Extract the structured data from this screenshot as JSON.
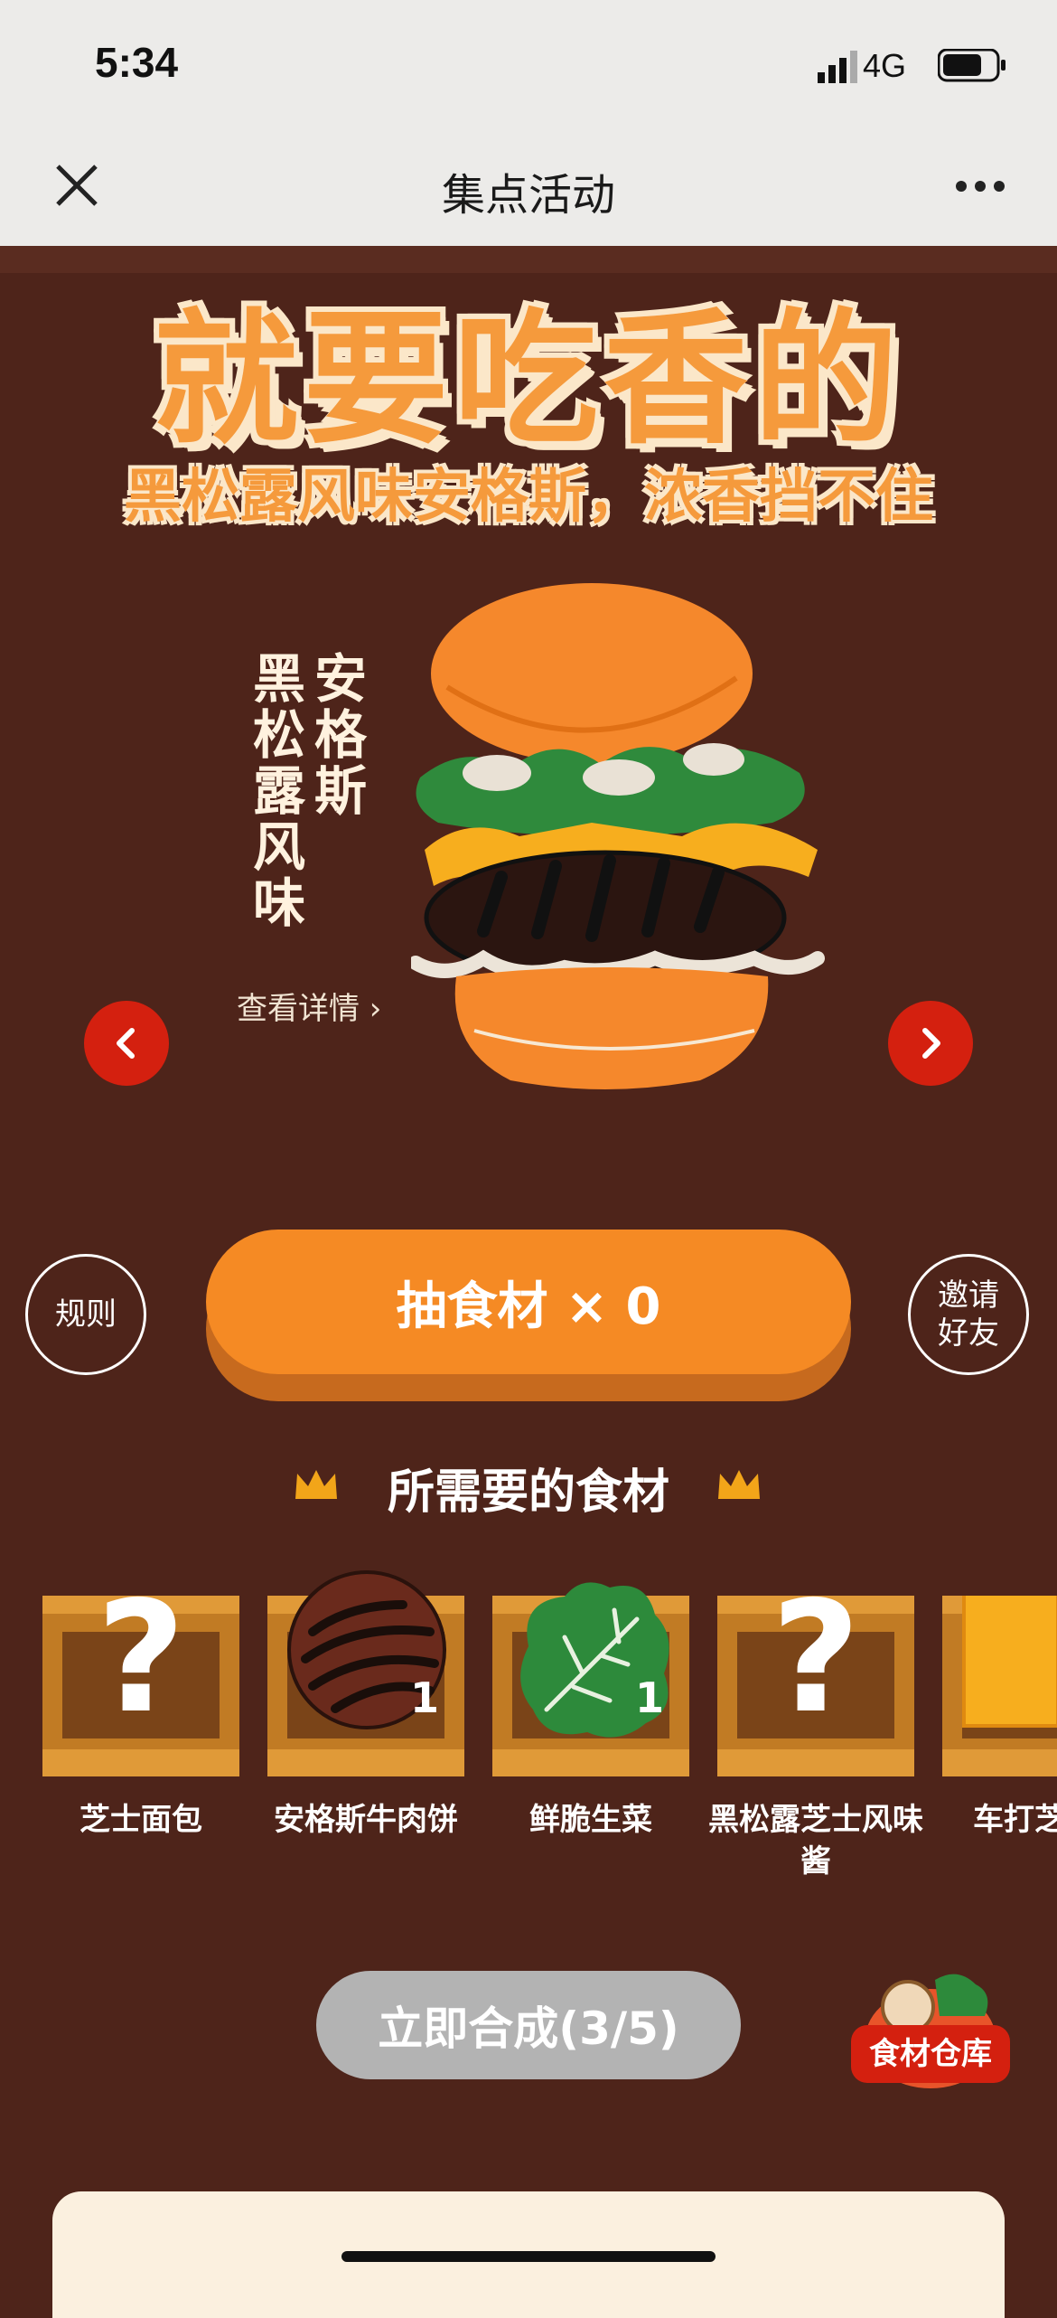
{
  "status_bar": {
    "time": "5:34",
    "network": "4G"
  },
  "nav": {
    "title": "集点活动"
  },
  "hero": {
    "headline": "就要吃香的",
    "subheadline": "黑松露风味安格斯，浓香挡不住",
    "product_name_col1": "黑松露风味",
    "product_name_col2": "安格斯",
    "detail_link": "查看详情 ›"
  },
  "actions": {
    "rules_label": "规则",
    "draw_label": "抽食材  × 0",
    "invite_label_line1": "邀请",
    "invite_label_line2": "好友"
  },
  "ingredients": {
    "section_title": "所需要的食材",
    "items": [
      {
        "name": "芝士面包",
        "count": ""
      },
      {
        "name": "安格斯牛肉饼",
        "count": "1"
      },
      {
        "name": "鲜脆生菜",
        "count": "1"
      },
      {
        "name": "黑松露芝士风味酱",
        "count": ""
      },
      {
        "name": "车打芝",
        "count": ""
      }
    ]
  },
  "combine": {
    "label": "立即合成(3/5)"
  },
  "warehouse": {
    "label": "食材仓库"
  },
  "colors": {
    "background": "#4e241a",
    "accent": "#f58a24",
    "arrow": "#d4200f"
  }
}
